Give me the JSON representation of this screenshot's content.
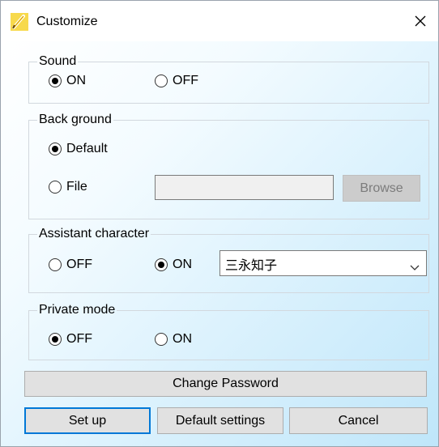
{
  "window": {
    "title": "Customize"
  },
  "icons": {
    "app": "pencil-icon",
    "close": "close-icon",
    "dropdown": "chevron-down-icon"
  },
  "colors": {
    "accent": "#0078d7",
    "group_border": "#d2d8de",
    "button_bg": "#e1e1e1"
  },
  "sound": {
    "label": "Sound",
    "on_label": "ON",
    "off_label": "OFF",
    "selected": "ON"
  },
  "background": {
    "label": "Back ground",
    "default_label": "Default",
    "file_label": "File",
    "file_path": "",
    "browse_label": "Browse",
    "selected": "Default"
  },
  "assistant": {
    "label": "Assistant character",
    "off_label": "OFF",
    "on_label": "ON",
    "selected": "ON",
    "character": "三永知子"
  },
  "private_mode": {
    "label": "Private mode",
    "off_label": "OFF",
    "on_label": "ON",
    "selected": "OFF"
  },
  "buttons": {
    "change_password": "Change Password",
    "set_up": "Set up",
    "default_settings": "Default settings",
    "cancel": "Cancel"
  }
}
